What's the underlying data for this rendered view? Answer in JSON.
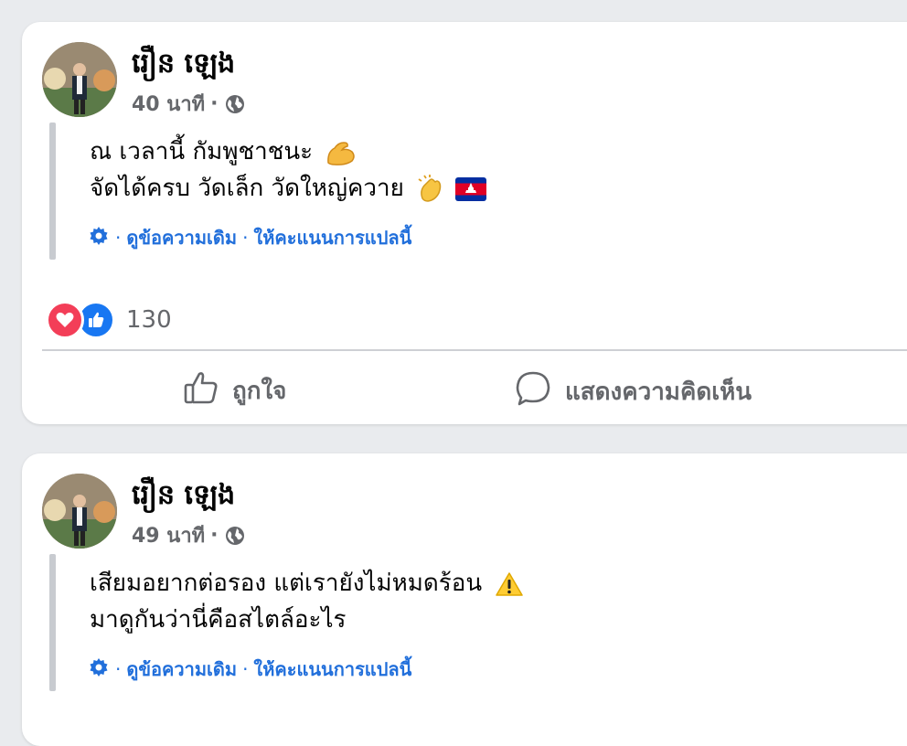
{
  "posts": [
    {
      "author": "រឿន ឡេង",
      "time": "40 นาที",
      "separator": "·",
      "lines": [
        "ณ เวลานี้ กัมพูชาชนะ",
        "จัดได้ครบ วัดเล็ก วัดใหญ่ควาย"
      ],
      "emojis_line1": [
        "flexed-biceps"
      ],
      "emojis_line2": [
        "clapping-hands",
        "cambodia-flag"
      ],
      "translate": {
        "see_original": "ดูข้อความเดิม",
        "rate": "ให้คะแนนการแปลนี้",
        "sep": "·"
      },
      "reactions": {
        "types": [
          "love",
          "like"
        ],
        "count": "130"
      },
      "actions": {
        "like": "ถูกใจ",
        "comment": "แสดงความคิดเห็น"
      }
    },
    {
      "author": "រឿន ឡេង",
      "time": "49 นาที",
      "separator": "·",
      "lines": [
        "เสียมอยากต่อรอง แต่เรายังไม่หมดร้อน",
        "มาดูกันว่านี่คือสไตล์อะไร"
      ],
      "emojis_line1": [
        "warning-sign"
      ],
      "translate": {
        "see_original": "ดูข้อความเดิม",
        "rate": "ให้คะแนนการแปลนี้",
        "sep": "·"
      }
    }
  ],
  "colors": {
    "link": "#216fdb",
    "like": "#1877f2",
    "love": "#f33e58",
    "muted": "#65676b"
  }
}
